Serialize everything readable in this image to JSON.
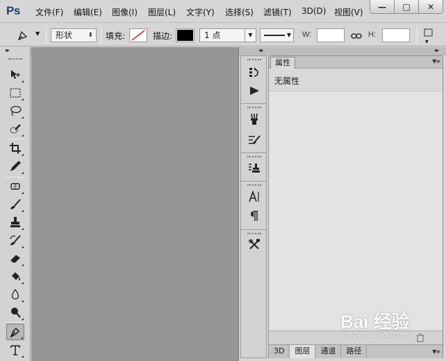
{
  "app": {
    "logo": "Ps"
  },
  "menu": [
    "文件(F)",
    "编辑(E)",
    "图像(I)",
    "图层(L)",
    "文字(Y)",
    "选择(S)",
    "滤镜(T)",
    "3D(D)",
    "视图(V)"
  ],
  "window_controls": {
    "minimize": "—",
    "maximize": "□",
    "close": "✕"
  },
  "options": {
    "mode_value": "形状",
    "fill_label": "填充:",
    "stroke_label": "描边:",
    "stroke_size": "1 点",
    "w_label": "W:",
    "h_label": "H:",
    "w_value": "",
    "h_value": "",
    "fill_color": "#ffffff",
    "stroke_color": "#000000"
  },
  "tools": [
    "move-tool-icon",
    "marquee-tool-icon",
    "lasso-tool-icon",
    "quick-select-tool-icon",
    "crop-tool-icon",
    "eyedropper-tool-icon",
    "healing-brush-tool-icon",
    "brush-tool-icon",
    "clone-stamp-tool-icon",
    "history-brush-tool-icon",
    "eraser-tool-icon",
    "paint-bucket-tool-icon",
    "blur-tool-icon",
    "dodge-tool-icon",
    "pen-tool-icon",
    "type-tool-icon"
  ],
  "active_tool": "pen-tool-icon",
  "dock_icons": [
    "history-panel-icon",
    "actions-panel-icon",
    "brush-presets-icon",
    "brush-panel-icon",
    "clone-source-icon",
    "character-panel-icon",
    "paragraph-panel-icon",
    "tool-presets-icon"
  ],
  "properties": {
    "tab_label": "属性",
    "empty_text": "无属性"
  },
  "bottom_tabs": [
    "3D",
    "图层",
    "通道",
    "路径"
  ],
  "active_bottom_tab": "图层",
  "watermark": {
    "brand": "Bai 经验",
    "url": "jingyan.baidu.com"
  },
  "colors": {
    "accent_logo": "#1f3f7a",
    "canvas": "#959595",
    "panel": "#d6d6d6"
  }
}
